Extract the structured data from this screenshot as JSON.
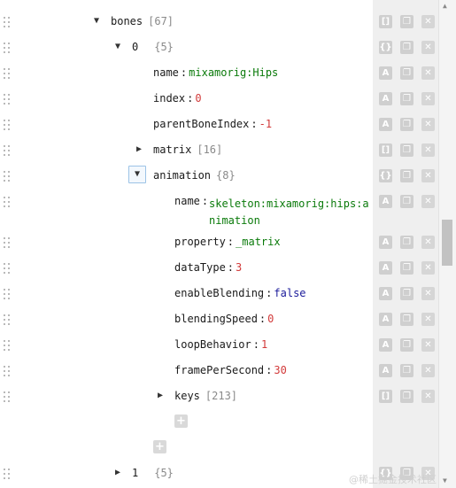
{
  "rows": {
    "bones": {
      "key": "bones",
      "count": "[67]",
      "toggle": "▼"
    },
    "item0": {
      "key": "0",
      "count": "{5}",
      "toggle": "▼"
    },
    "name": {
      "key": "name",
      "sep": ":",
      "value": "mixamorig:Hips"
    },
    "index": {
      "key": "index",
      "sep": ":",
      "value": "0"
    },
    "parent": {
      "key": "parentBoneIndex",
      "sep": ":",
      "value": "-1"
    },
    "matrix": {
      "key": "matrix",
      "count": "[16]",
      "toggle": "▶"
    },
    "animation": {
      "key": "animation",
      "count": "{8}",
      "toggle": "▼"
    },
    "anim_name": {
      "key": "name",
      "sep": ":",
      "value": "skeleton:mixamorig:hips:animation"
    },
    "property": {
      "key": "property",
      "sep": ":",
      "value": "_matrix"
    },
    "dataType": {
      "key": "dataType",
      "sep": ":",
      "value": "3"
    },
    "enableBlending": {
      "key": "enableBlending",
      "sep": ":",
      "value": "false"
    },
    "blendingSpeed": {
      "key": "blendingSpeed",
      "sep": ":",
      "value": "0"
    },
    "loopBehavior": {
      "key": "loopBehavior",
      "sep": ":",
      "value": "1"
    },
    "framePerSecond": {
      "key": "framePerSecond",
      "sep": ":",
      "value": "30"
    },
    "keys": {
      "key": "keys",
      "count": "[213]",
      "toggle": "▶"
    },
    "item1": {
      "key": "1",
      "count": "{5}",
      "toggle": "▶"
    }
  },
  "icons": {
    "array_type": "[]",
    "object_type": "{}",
    "auto_type": "A",
    "duplicate": "❐",
    "remove": "✕",
    "add": "+"
  },
  "watermark": "@稀土掘金技术社区",
  "colors": {
    "string": "#0a7a0a",
    "number": "#d23a3a",
    "boolean": "#1a1a9a",
    "button": "#cfcfcf"
  }
}
